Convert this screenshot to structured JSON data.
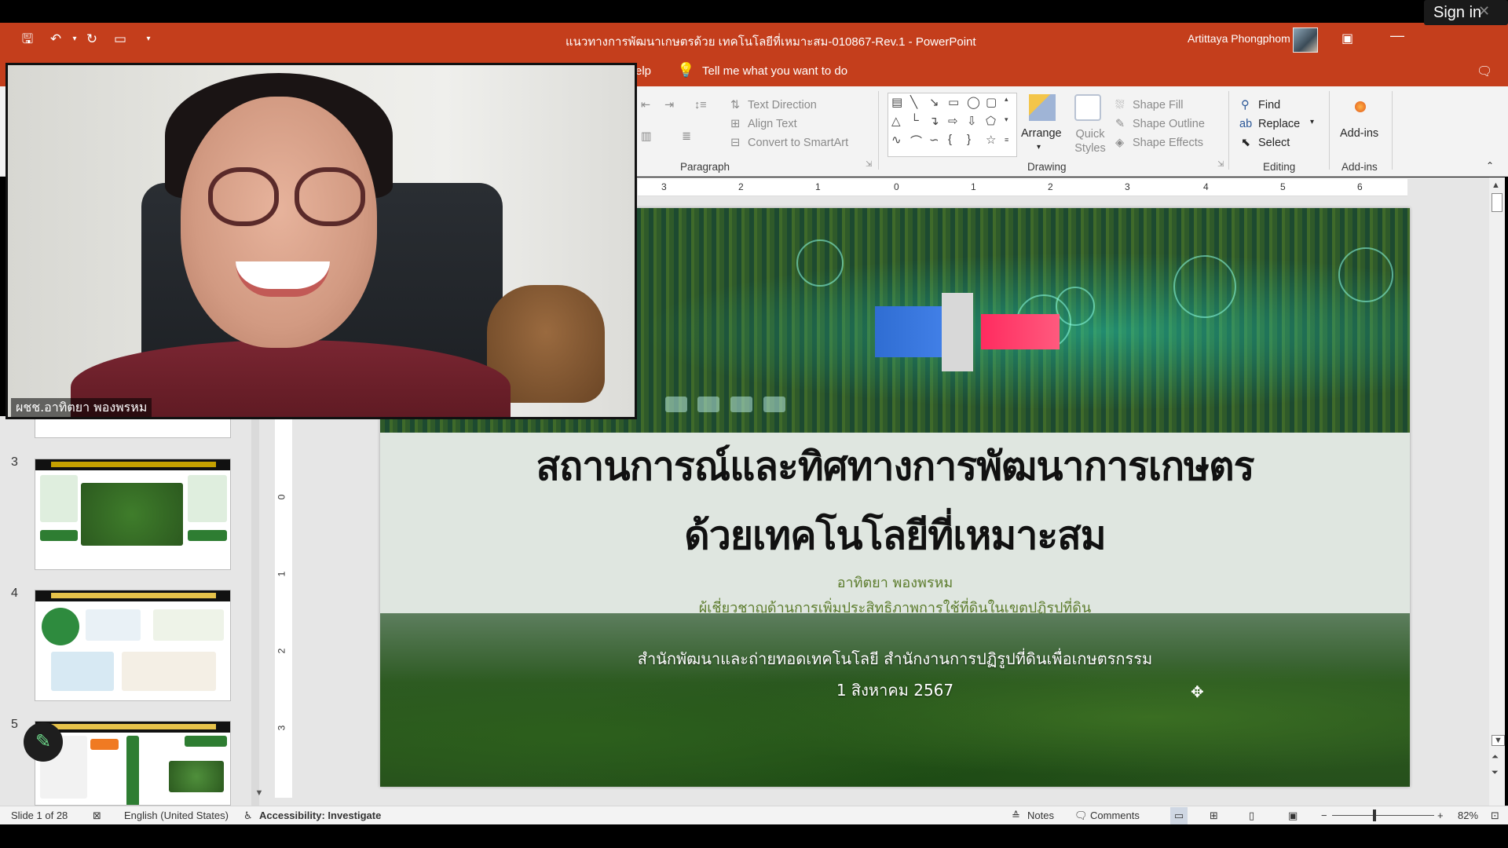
{
  "window": {
    "title": "แนวทางการพัฒนาเกษตรด้วย เทคโนโลยีที่เหมาะสม-010867-Rev.1  -  PowerPoint",
    "user_name": "Artittaya Phongphom",
    "sign_in": "Sign in"
  },
  "tellbar": {
    "help_tab": "elp",
    "tell_me": "Tell me what you want to do"
  },
  "ribbon": {
    "paragraph": {
      "label": "Paragraph",
      "text_direction": "Text Direction",
      "align_text": "Align Text",
      "convert_smartart": "Convert to SmartArt"
    },
    "drawing": {
      "label": "Drawing",
      "arrange": "Arrange",
      "quick_styles": "Quick Styles",
      "shape_fill": "Shape Fill",
      "shape_outline": "Shape Outline",
      "shape_effects": "Shape Effects"
    },
    "editing": {
      "label": "Editing",
      "find": "Find",
      "replace": "Replace",
      "select": "Select"
    },
    "addins": {
      "label": "Add-ins",
      "button": "Add-ins"
    }
  },
  "ruler": {
    "marks": [
      "3",
      "2",
      "1",
      "0",
      "1",
      "2",
      "3",
      "4",
      "5",
      "6"
    ]
  },
  "vruler": {
    "marks": [
      "0",
      "1",
      "2",
      "3"
    ]
  },
  "thumbnails": [
    {
      "num": "3"
    },
    {
      "num": "4"
    },
    {
      "num": "5"
    }
  ],
  "slide": {
    "title_line1": "สถานการณ์และทิศทางการพัฒนาการเกษตร",
    "title_line2": "ด้วยเทคโนโลยีที่เหมาะสม",
    "author": "อาทิตยา  พองพรหม",
    "role": "ผู้เชี่ยวชาญด้านการเพิ่มประสิทธิภาพการใช้ที่ดินในเขตปฏิรูปที่ดิน",
    "org": "สำนักพัฒนาและถ่ายทอดเทคโนโลยี สำนักงานการปฏิรูปที่ดินเพื่อเกษตรกรรม",
    "date": "1 สิงหาคม 2567"
  },
  "video": {
    "name_label": "ผชช.อาทิตยา  พองพรหม"
  },
  "statusbar": {
    "slide_info": "Slide 1 of 28",
    "language": "English (United States)",
    "accessibility": "Accessibility: Investigate",
    "notes": "Notes",
    "comments": "Comments",
    "zoom": "82%"
  }
}
